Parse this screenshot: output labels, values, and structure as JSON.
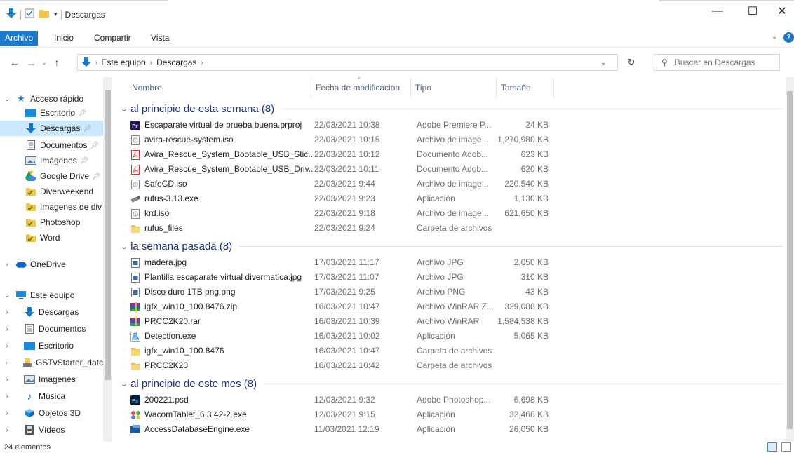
{
  "window": {
    "title": "Descargas",
    "controls": {
      "minimize": "—",
      "maximize": "☐",
      "close": "✕"
    }
  },
  "ribbon": {
    "tabs": [
      "Archivo",
      "Inicio",
      "Compartir",
      "Vista"
    ],
    "active_tab": "Archivo",
    "help_icon": "?"
  },
  "address": {
    "segments": [
      "Este equipo",
      "Descargas"
    ],
    "search_placeholder": "Buscar en Descargas"
  },
  "nav_pane": {
    "quick_access": "Acceso rápido",
    "quick_items": [
      "Escritorio",
      "Descargas",
      "Documentos",
      "Imágenes",
      "Google Drive",
      "Diverweekend",
      "Imagenes de div",
      "Photoshop",
      "Word"
    ],
    "onedrive": "OneDrive",
    "this_pc": "Este equipo",
    "pc_items": [
      "Descargas",
      "Documentos",
      "Escritorio",
      "GSTvStarter_datc",
      "Imágenes",
      "Música",
      "Objetos 3D",
      "Vídeos"
    ]
  },
  "columns": [
    "Nombre",
    "Fecha de modificación",
    "Tipo",
    "Tamaño"
  ],
  "groups": [
    {
      "label": "al principio de esta semana (8)",
      "files": [
        {
          "name": "Escaparate virtual de prueba buena.prproj",
          "date": "22/03/2021 10:38",
          "type": "Adobe Premiere P...",
          "size": "24 KB",
          "icon": "premiere-icon"
        },
        {
          "name": "avira-rescue-system.iso",
          "date": "22/03/2021 10:15",
          "type": "Archivo de image...",
          "size": "1,270,980 KB",
          "icon": "disc-image-icon"
        },
        {
          "name": "Avira_Rescue_System_Bootable_USB_Stic...",
          "date": "22/03/2021 10:12",
          "type": "Documento Adob...",
          "size": "623 KB",
          "icon": "pdf-icon"
        },
        {
          "name": "Avira_Rescue_System_Bootable_USB_Driv...",
          "date": "22/03/2021 10:11",
          "type": "Documento Adob...",
          "size": "620 KB",
          "icon": "pdf-icon"
        },
        {
          "name": "SafeCD.iso",
          "date": "22/03/2021 9:44",
          "type": "Archivo de image...",
          "size": "220,540 KB",
          "icon": "disc-image-icon"
        },
        {
          "name": "rufus-3.13.exe",
          "date": "22/03/2021 9:23",
          "type": "Aplicación",
          "size": "1,130 KB",
          "icon": "usb-app-icon"
        },
        {
          "name": "krd.iso",
          "date": "22/03/2021 9:18",
          "type": "Archivo de image...",
          "size": "621,650 KB",
          "icon": "disc-image-icon"
        },
        {
          "name": "rufus_files",
          "date": "22/03/2021 9:24",
          "type": "Carpeta de archivos",
          "size": "",
          "icon": "folder-icon"
        }
      ]
    },
    {
      "label": "la semana pasada (8)",
      "files": [
        {
          "name": "madera.jpg",
          "date": "17/03/2021 11:17",
          "type": "Archivo JPG",
          "size": "2,050 KB",
          "icon": "image-file-icon"
        },
        {
          "name": "Plantilla escaparate virtual divermatica.jpg",
          "date": "17/03/2021 11:07",
          "type": "Archivo JPG",
          "size": "310 KB",
          "icon": "image-file-icon"
        },
        {
          "name": "Disco duro 1TB png.png",
          "date": "17/03/2021 9:25",
          "type": "Archivo PNG",
          "size": "43 KB",
          "icon": "image-file-icon"
        },
        {
          "name": "igfx_win10_100.8476.zip",
          "date": "16/03/2021 10:47",
          "type": "Archivo WinRAR Z...",
          "size": "329,088 KB",
          "icon": "winrar-icon"
        },
        {
          "name": "PRCC2K20.rar",
          "date": "16/03/2021 10:39",
          "type": "Archivo WinRAR",
          "size": "1,584,538 KB",
          "icon": "winrar-icon"
        },
        {
          "name": "Detection.exe",
          "date": "16/03/2021 10:02",
          "type": "Aplicación",
          "size": "5,065 KB",
          "icon": "flask-app-icon"
        },
        {
          "name": "igfx_win10_100.8476",
          "date": "16/03/2021 10:47",
          "type": "Carpeta de archivos",
          "size": "",
          "icon": "folder-icon"
        },
        {
          "name": "PRCC2K20",
          "date": "16/03/2021 10:42",
          "type": "Carpeta de archivos",
          "size": "",
          "icon": "folder-icon"
        }
      ]
    },
    {
      "label": "al principio de este mes (8)",
      "files": [
        {
          "name": "200221.psd",
          "date": "12/03/2021 9:32",
          "type": "Adobe Photoshop...",
          "size": "6,698 KB",
          "icon": "photoshop-icon"
        },
        {
          "name": "WacomTablet_6.3.42-2.exe",
          "date": "12/03/2021 9:15",
          "type": "Aplicación",
          "size": "32,466 KB",
          "icon": "wacom-app-icon"
        },
        {
          "name": "AccessDatabaseEngine.exe",
          "date": "11/03/2021 12:19",
          "type": "Aplicación",
          "size": "26,050 KB",
          "icon": "access-app-icon"
        }
      ]
    }
  ],
  "status": {
    "count": "24 elementos"
  },
  "colors": {
    "accent": "#1979ca",
    "group_heading": "#1e3287",
    "selection": "#cce8ff",
    "folder": "#f3c449"
  }
}
